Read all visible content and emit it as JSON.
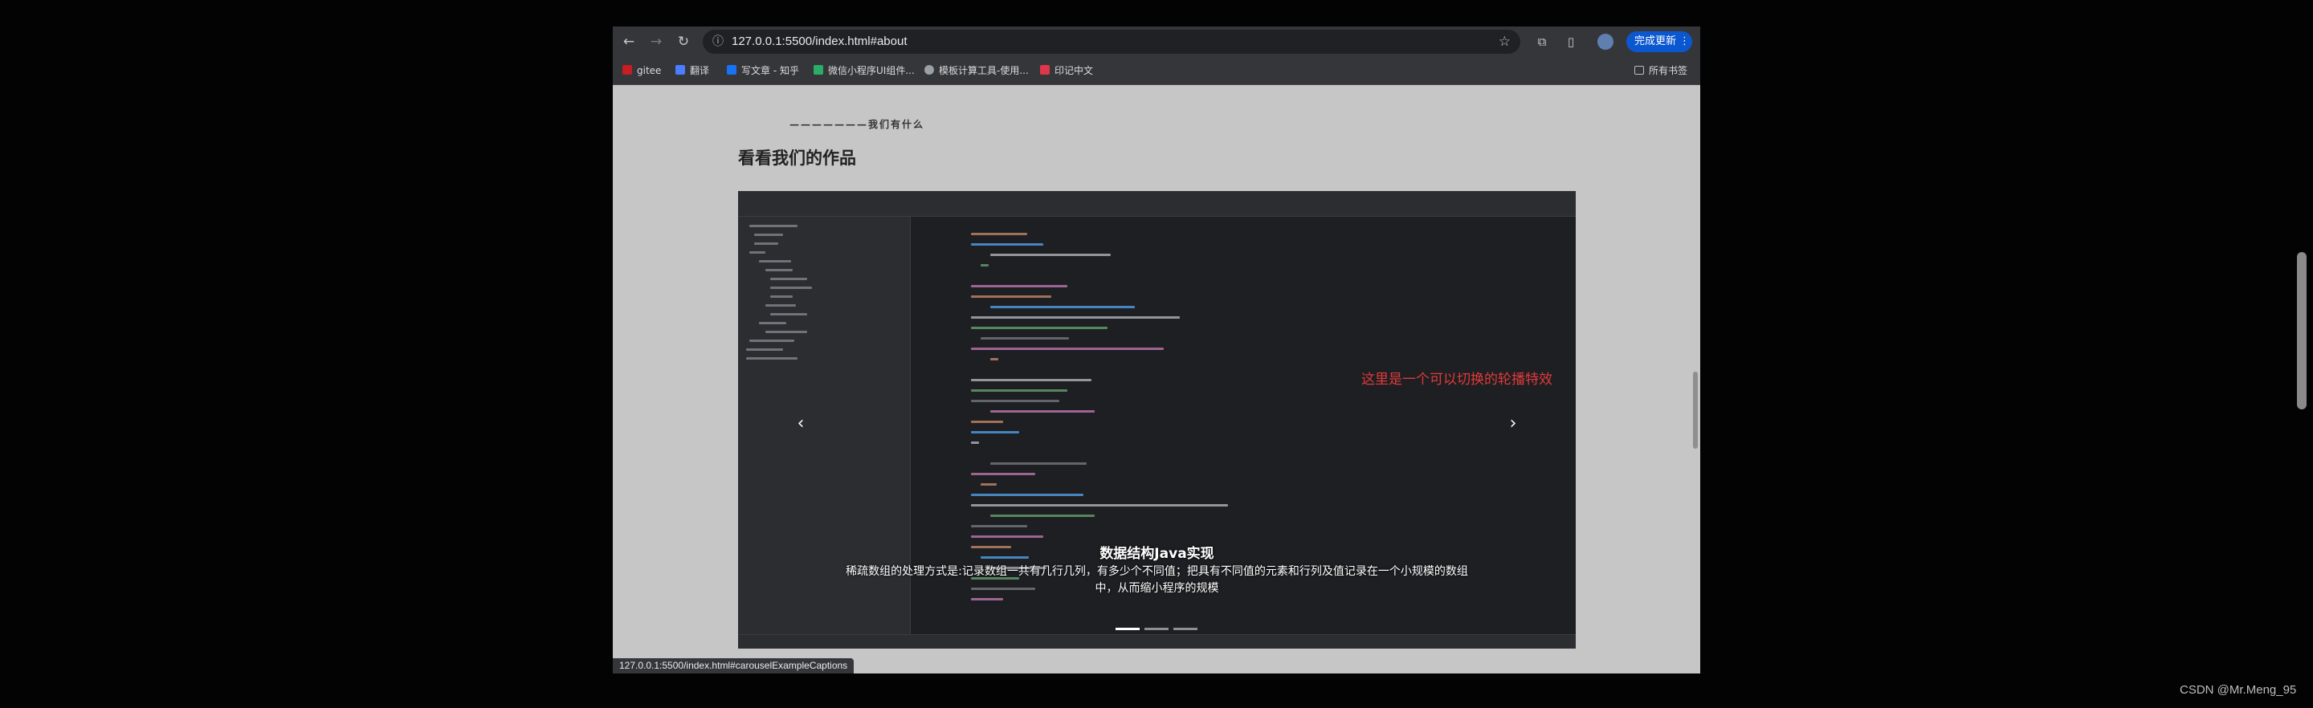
{
  "browser": {
    "url": "127.0.0.1:5500/index.html#about",
    "update_button": "完成更新",
    "nav": {
      "back_icon": "arrow-left-icon",
      "forward_icon": "arrow-right-icon",
      "reload_icon": "reload-icon"
    }
  },
  "bookmarks": {
    "items": [
      {
        "label": "gitee",
        "color": "#c71d23"
      },
      {
        "label": "翻译",
        "color": "#4a7dff"
      },
      {
        "label": "写文章 - 知乎",
        "color": "#1772f6"
      },
      {
        "label": "微信小程序UI组件...",
        "color": "#2aae67"
      },
      {
        "label": "模板计算工具-使用...",
        "color": "#9aa0a6"
      },
      {
        "label": "印记中文",
        "color": "#e0364b"
      }
    ],
    "all_bookmarks": "所有书签"
  },
  "page": {
    "eyebrow": "———————我们有什么",
    "heading": "看看我们的作品"
  },
  "carousel": {
    "overlay_text": "这里是一个可以切换的轮播特效",
    "caption_title": "数据结构Java实现",
    "caption_desc": "稀疏数组的处理方式是:记录数组一共有几行几列，有多少个不同值；把具有不同值的元素和行列及值记录在一个小规模的数组中，从而缩小程序的规模",
    "slides_count": 3,
    "active_slide": 1,
    "prev_icon": "chevron-left-icon",
    "next_icon": "chevron-right-icon"
  },
  "status_url": "127.0.0.1:5500/index.html#carouselExampleCaptions",
  "watermark": "CSDN @Mr.Meng_95",
  "colors": {
    "accent": "#0b57d0",
    "overlay_red": "#e03a3a",
    "page_bg": "#c6c6c6"
  }
}
